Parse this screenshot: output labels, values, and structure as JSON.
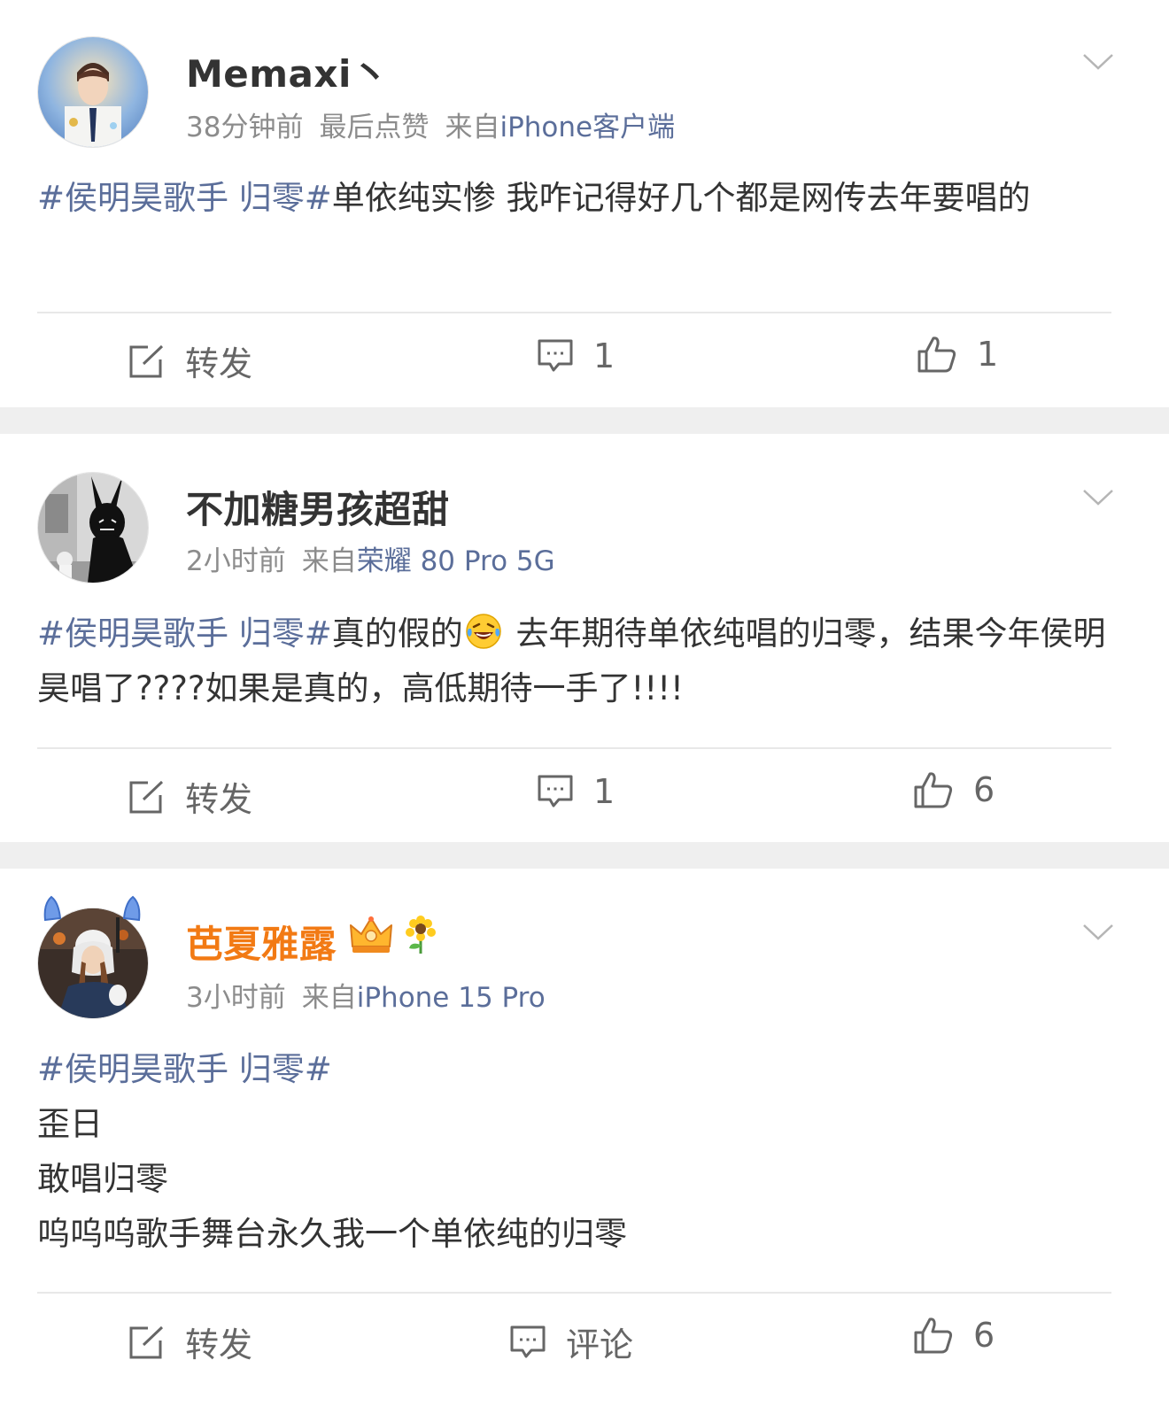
{
  "posts": [
    {
      "username": "Memaxi丶",
      "time": "38分钟前",
      "extra": "最后点赞",
      "source_prefix": "来自",
      "source": "iPhone客户端",
      "topic": "#侯明昊歌手 归零#",
      "text": "单依纯实惨 我咋记得好几个都是网传去年要唱的",
      "actions": {
        "repost": "转发",
        "comment": "1",
        "like": "1"
      }
    },
    {
      "username": "不加糖男孩超甜",
      "time": "2小时前",
      "source_prefix": "来自",
      "source": "荣耀 80 Pro 5G",
      "topic": "#侯明昊歌手 归零#",
      "text_a": "真的假的",
      "emoji": "laugh-cry-emoji",
      "text_b": " 去年期待单依纯唱的归零，结果今年侯明昊唱了????如果是真的，高低期待一手了!!!!",
      "actions": {
        "repost": "转发",
        "comment": "1",
        "like": "6"
      }
    },
    {
      "username": "芭夏雅露",
      "time": "3小时前",
      "source_prefix": "来自",
      "source": "iPhone 15 Pro",
      "topic": "#侯明昊歌手 归零#",
      "lines": [
        "歪日",
        "敢唱归零",
        "呜呜呜歌手舞台永久我一个单依纯的归零"
      ],
      "actions": {
        "repost": "转发",
        "comment": "评论",
        "like": "6"
      }
    }
  ],
  "colors": {
    "topic": "#5b6e9a",
    "meta": "#8c8c8c",
    "vip_name": "#f27a14",
    "separator": "#efefef"
  }
}
